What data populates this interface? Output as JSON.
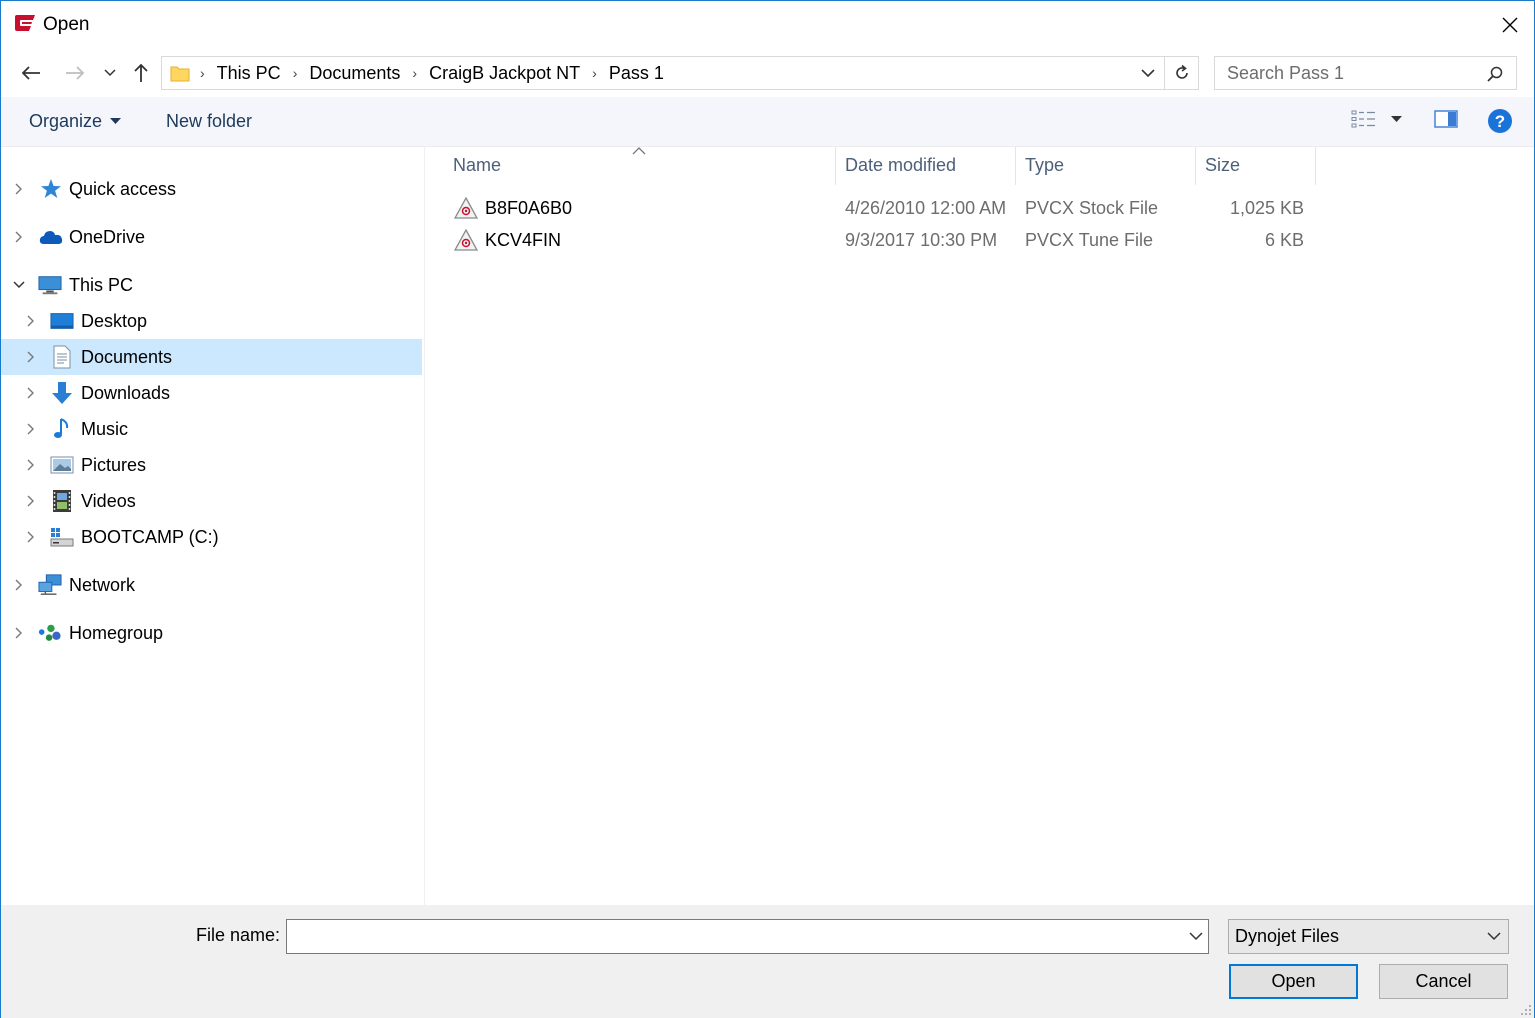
{
  "window": {
    "title": "Open"
  },
  "address": {
    "crumbs": [
      "This PC",
      "Documents",
      "CraigB Jackpot NT",
      "Pass 1"
    ]
  },
  "search": {
    "placeholder": "Search Pass 1"
  },
  "toolbar": {
    "organize_label": "Organize",
    "new_folder_label": "New folder"
  },
  "nav": {
    "items": [
      {
        "label": "Quick access",
        "icon": "star-icon"
      },
      {
        "label": "OneDrive",
        "icon": "cloud-icon"
      },
      {
        "label": "This PC",
        "icon": "computer-icon"
      },
      {
        "label": "Desktop",
        "icon": "desktop-icon"
      },
      {
        "label": "Documents",
        "icon": "documents-icon"
      },
      {
        "label": "Downloads",
        "icon": "download-arrow-icon"
      },
      {
        "label": "Music",
        "icon": "music-note-icon"
      },
      {
        "label": "Pictures",
        "icon": "pictures-icon"
      },
      {
        "label": "Videos",
        "icon": "film-icon"
      },
      {
        "label": "BOOTCAMP (C:)",
        "icon": "drive-icon"
      },
      {
        "label": "Network",
        "icon": "network-icon"
      },
      {
        "label": "Homegroup",
        "icon": "homegroup-icon"
      }
    ],
    "selected": "Documents"
  },
  "columns": {
    "name": "Name",
    "date": "Date modified",
    "type": "Type",
    "size": "Size"
  },
  "files": [
    {
      "name": "B8F0A6B0",
      "date": "4/26/2010 12:00 AM",
      "type": "PVCX Stock File",
      "size": "1,025 KB"
    },
    {
      "name": "KCV4FIN",
      "date": "9/3/2017 10:30 PM",
      "type": "PVCX Tune File",
      "size": "6 KB"
    }
  ],
  "bottom": {
    "file_name_label": "File name:",
    "file_name_value": "",
    "filter": "Dynojet Files",
    "open_label": "Open",
    "cancel_label": "Cancel"
  },
  "colors": {
    "accent": "#0078d7",
    "selection": "#cce8ff",
    "link": "#1e395b"
  }
}
